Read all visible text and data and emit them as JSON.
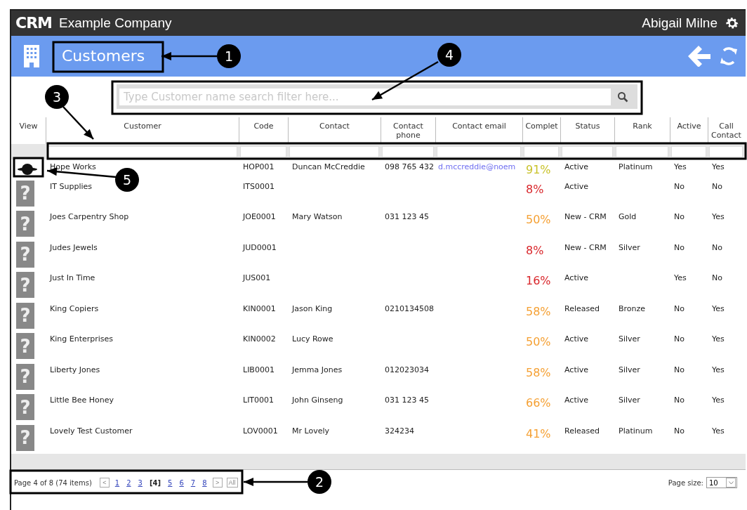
{
  "topbar": {
    "logo": "CRM",
    "company": "Example Company",
    "user": "Abigail Milne"
  },
  "titlebar": {
    "title": "Customers"
  },
  "search": {
    "placeholder": "Type Customer name search filter here..."
  },
  "table": {
    "columns": [
      {
        "label": "View"
      },
      {
        "label": "Customer"
      },
      {
        "label": "Code"
      },
      {
        "label": "Contact"
      },
      {
        "label": "Contact phone"
      },
      {
        "label": "Contact email"
      },
      {
        "label": "Complet"
      },
      {
        "label": "Status"
      },
      {
        "label": "Rank"
      },
      {
        "label": "Active"
      },
      {
        "label": "Call Contact"
      }
    ],
    "rows": [
      {
        "view": {
          "kind": "logo"
        },
        "customer": "Hope Works",
        "code": "HOP001",
        "contact": "Duncan McCreddie",
        "phone": "098 765 432",
        "email": "d.mccreddie@noem",
        "complete": "91%",
        "color": "#c9c22a",
        "status": "Active",
        "rank": "Platinum",
        "active": "Yes",
        "call": "Yes"
      },
      {
        "view": {
          "kind": "placeholder",
          "glyph": "?"
        },
        "customer": "IT Supplies",
        "code": "ITS0001",
        "contact": "",
        "phone": "",
        "email": "",
        "complete": "8%",
        "color": "#d9262b",
        "status": "Active",
        "rank": "",
        "active": "No",
        "call": "No"
      },
      {
        "view": {
          "kind": "placeholder",
          "glyph": "?"
        },
        "customer": "Joes Carpentry Shop",
        "code": "JOE0001",
        "contact": "Mary Watson",
        "phone": "031 123 45",
        "email": "",
        "complete": "50%",
        "color": "#f5a033",
        "status": "New - CRM",
        "rank": "Gold",
        "active": "No",
        "call": "Yes"
      },
      {
        "view": {
          "kind": "placeholder",
          "glyph": "?"
        },
        "customer": "Judes Jewels",
        "code": "JUD0001",
        "contact": "",
        "phone": "",
        "email": "",
        "complete": "8%",
        "color": "#d9262b",
        "status": "New - CRM",
        "rank": "Silver",
        "active": "No",
        "call": "No"
      },
      {
        "view": {
          "kind": "placeholder",
          "glyph": "?"
        },
        "customer": "Just In Time",
        "code": "JUS001",
        "contact": "",
        "phone": "",
        "email": "",
        "complete": "16%",
        "color": "#d9262b",
        "status": "Active",
        "rank": "",
        "active": "Yes",
        "call": "No"
      },
      {
        "view": {
          "kind": "placeholder",
          "glyph": "?"
        },
        "customer": "King Copiers",
        "code": "KIN0001",
        "contact": "Jason King",
        "phone": "0210134508",
        "email": "",
        "complete": "58%",
        "color": "#f5a033",
        "status": "Released",
        "rank": "Bronze",
        "active": "No",
        "call": "Yes"
      },
      {
        "view": {
          "kind": "placeholder",
          "glyph": "?"
        },
        "customer": "King Enterprises",
        "code": "KIN0002",
        "contact": "Lucy Rowe",
        "phone": "",
        "email": "",
        "complete": "50%",
        "color": "#f5a033",
        "status": "Active",
        "rank": "Silver",
        "active": "No",
        "call": "Yes"
      },
      {
        "view": {
          "kind": "placeholder",
          "glyph": "?"
        },
        "customer": "Liberty Jones",
        "code": "LIB0001",
        "contact": "Jemma Jones",
        "phone": "012023034",
        "email": "",
        "complete": "58%",
        "color": "#f5a033",
        "status": "Active",
        "rank": "Silver",
        "active": "No",
        "call": "Yes"
      },
      {
        "view": {
          "kind": "placeholder",
          "glyph": "?"
        },
        "customer": "Little Bee Honey",
        "code": "LIT0001",
        "contact": "John Ginseng",
        "phone": "031 123 45",
        "email": "",
        "complete": "66%",
        "color": "#f5a033",
        "status": "Active",
        "rank": "Silver",
        "active": "No",
        "call": "Yes"
      },
      {
        "view": {
          "kind": "placeholder",
          "glyph": "?"
        },
        "customer": "Lovely Test Customer",
        "code": "LOV0001",
        "contact": "Mr Lovely",
        "phone": "324234",
        "email": "",
        "complete": "41%",
        "color": "#f5a033",
        "status": "Released",
        "rank": "Platinum",
        "active": "No",
        "call": "Yes"
      }
    ]
  },
  "pager": {
    "summary": "Page 4 of 8 (74 items)",
    "prev": "<",
    "next": ">",
    "all": "All",
    "pages": [
      {
        "label": "1",
        "selected": false
      },
      {
        "label": "2",
        "selected": false
      },
      {
        "label": "3",
        "selected": false
      },
      {
        "label": "[4]",
        "selected": true
      },
      {
        "label": "5",
        "selected": false
      },
      {
        "label": "6",
        "selected": false
      },
      {
        "label": "7",
        "selected": false
      },
      {
        "label": "8",
        "selected": false
      }
    ],
    "page_size_label": "Page size:",
    "page_size": "10"
  },
  "callouts": [
    {
      "number": "1"
    },
    {
      "number": "2"
    },
    {
      "number": "3"
    },
    {
      "number": "4"
    },
    {
      "number": "5"
    }
  ]
}
